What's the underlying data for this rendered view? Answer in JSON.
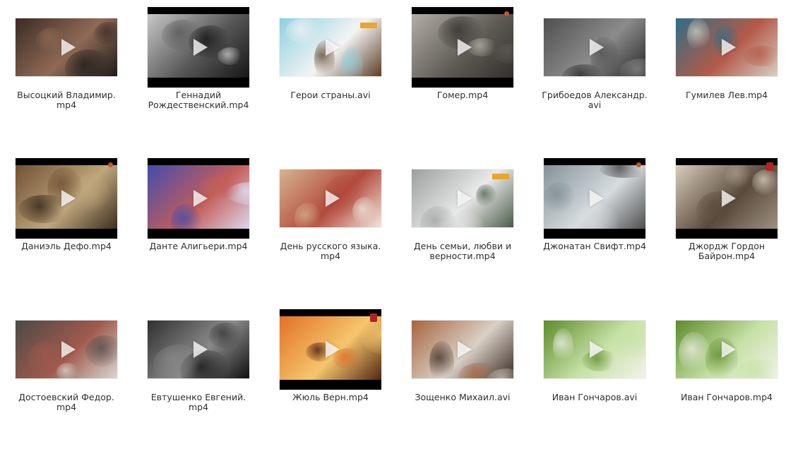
{
  "files": [
    {
      "name": "Высоцкий Владимир.\nmp4",
      "shape": "h16x9",
      "palette": [
        "#3b2a24",
        "#8f6a55",
        "#1e1c1a"
      ],
      "badge": "none"
    },
    {
      "name": "Геннадий\nРождественский.mp4",
      "shape": "h4x3",
      "palette": [
        "#d0d0d0",
        "#565656",
        "#0d0d0d"
      ],
      "badge": "none"
    },
    {
      "name": "Герои страны.avi",
      "shape": "h16x9",
      "palette": [
        "#8ed0e0",
        "#f3f4f4",
        "#5e3e24"
      ],
      "badge": "tag"
    },
    {
      "name": "Гомер.mp4",
      "shape": "h4x3",
      "palette": [
        "#b9b5ad",
        "#5f5b55",
        "#2b2927"
      ],
      "badge": "small"
    },
    {
      "name": "Грибоедов Александр.\navi",
      "shape": "h16x9",
      "palette": [
        "#4f4f4f",
        "#8c8c8c",
        "#252525"
      ],
      "badge": "none"
    },
    {
      "name": "Гумилев Лев.mp4",
      "shape": "h16x9",
      "palette": [
        "#2e6f86",
        "#b45a48",
        "#d7d0c4"
      ],
      "badge": "none"
    },
    {
      "name": "Даниэль Дефо.mp4",
      "shape": "h4x3",
      "palette": [
        "#6b4a2d",
        "#bfa67c",
        "#2a1d11"
      ],
      "badge": "small"
    },
    {
      "name": "Данте Алигьери.mp4",
      "shape": "h4x3",
      "palette": [
        "#384bb3",
        "#c35e5a",
        "#e0e7ff"
      ],
      "badge": "none"
    },
    {
      "name": "День русского языка.\nmp4",
      "shape": "h16x9",
      "palette": [
        "#d6b48f",
        "#b24a3d",
        "#f1e7db"
      ],
      "badge": "none"
    },
    {
      "name": "День семьи, любви и\nверности.mp4",
      "shape": "h16x9",
      "palette": [
        "#9aa09e",
        "#e9e9e9",
        "#4b5d49"
      ],
      "badge": "tag"
    },
    {
      "name": "Джонатан Свифт.mp4",
      "shape": "h4x3",
      "palette": [
        "#7e8b94",
        "#d7dcdf",
        "#3a3a3a"
      ],
      "badge": "small"
    },
    {
      "name": "Джордж Гордон\nБайрон.mp4",
      "shape": "h4x3",
      "palette": [
        "#e2d6c6",
        "#5a4a3c",
        "#a79b8b"
      ],
      "badge": "badge"
    },
    {
      "name": "Достоевский Федор.\nmp4",
      "shape": "h16x9",
      "palette": [
        "#4b4a48",
        "#a05a4c",
        "#d8d7d3"
      ],
      "badge": "none"
    },
    {
      "name": "Евтушенко Евгений.\nmp4",
      "shape": "h16x9",
      "palette": [
        "#2f2f2f",
        "#8a8a8a",
        "#0f0f0f"
      ],
      "badge": "none"
    },
    {
      "name": "Жюль Верн.mp4",
      "shape": "h4x3",
      "palette": [
        "#e06a21",
        "#f6c56d",
        "#3a1205"
      ],
      "badge": "badge"
    },
    {
      "name": "Зощенко Михаил.avi",
      "shape": "h16x9",
      "palette": [
        "#a7643d",
        "#d9d0c6",
        "#3a2b24"
      ],
      "badge": "none"
    },
    {
      "name": "Иван Гончаров.avi",
      "shape": "h16x9",
      "palette": [
        "#5d8b2a",
        "#c6e1a5",
        "#f2f2ea"
      ],
      "badge": "none"
    },
    {
      "name": "Иван Гончаров.mp4",
      "shape": "h16x9",
      "palette": [
        "#5d8b2a",
        "#c6e1a5",
        "#f2f2ea"
      ],
      "badge": "none"
    }
  ]
}
